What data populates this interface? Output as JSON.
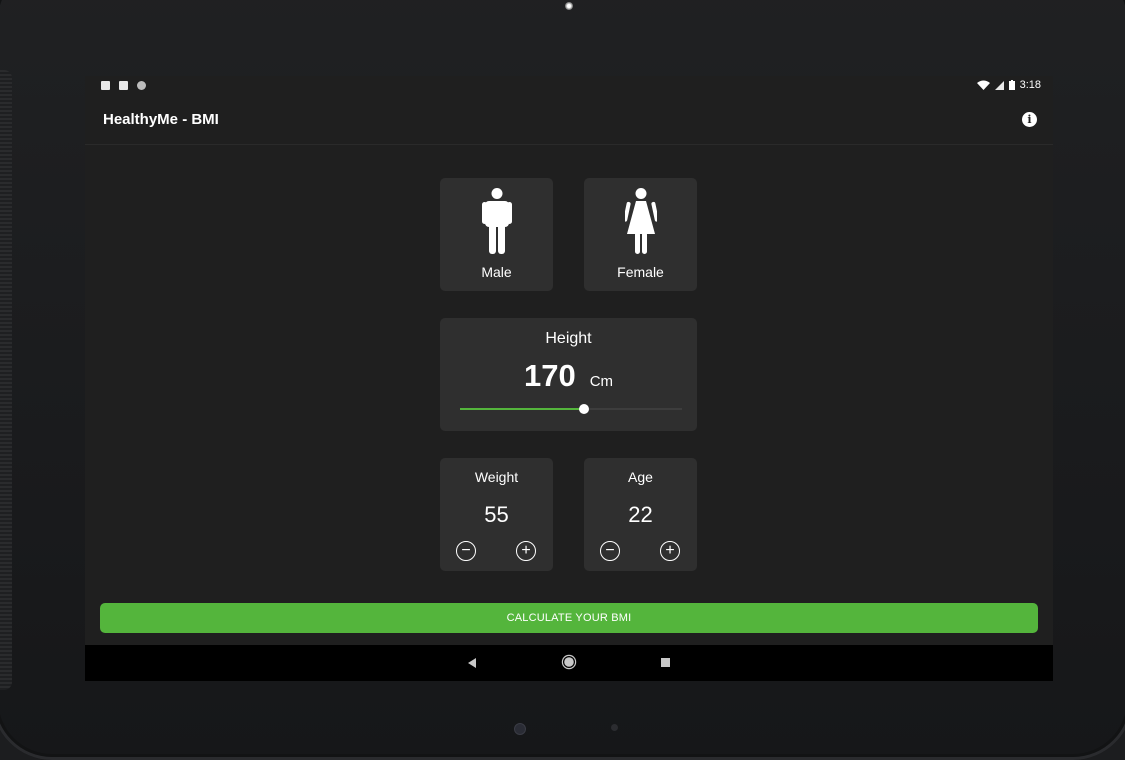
{
  "status": {
    "time": "3:18"
  },
  "appbar": {
    "title": "HealthyMe - BMI"
  },
  "gender": {
    "male_label": "Male",
    "female_label": "Female"
  },
  "height": {
    "title": "Height",
    "value": "170",
    "unit": "Cm",
    "slider_fraction": 0.56
  },
  "weight": {
    "title": "Weight",
    "value": "55"
  },
  "age": {
    "title": "Age",
    "value": "22"
  },
  "actions": {
    "calculate_label": "CALCULATE YOUR BMI"
  },
  "colors": {
    "accent": "#54b53c",
    "card": "#2f2f2f",
    "background": "#1f1f1f"
  },
  "icons": {
    "info": "info-icon",
    "male": "male-icon",
    "female": "female-icon",
    "decrement": "minus-circle-icon",
    "increment": "plus-circle-icon"
  }
}
